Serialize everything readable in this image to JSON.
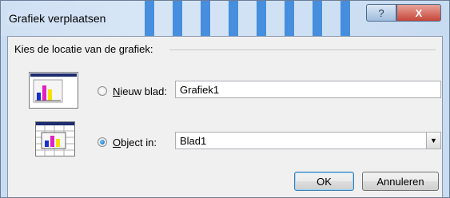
{
  "dialog": {
    "title": "Grafiek verplaatsen",
    "help_glyph": "?",
    "close_glyph": "X"
  },
  "group": {
    "label": "Kies de locatie van de grafiek:"
  },
  "options": [
    {
      "label_underlined": "N",
      "label_rest": "ieuw blad:",
      "value": "Grafiek1",
      "selected": false
    },
    {
      "label_underlined": "O",
      "label_rest": "bject in:",
      "value": "Blad1",
      "selected": true
    }
  ],
  "buttons": {
    "ok": "OK",
    "cancel": "Annuleren"
  },
  "colors": {
    "title_stripe": "#2e7fd9",
    "chart_bar_blue": "#1a2fd0",
    "chart_bar_magenta": "#e020c0",
    "chart_bar_yellow": "#f5e000"
  }
}
